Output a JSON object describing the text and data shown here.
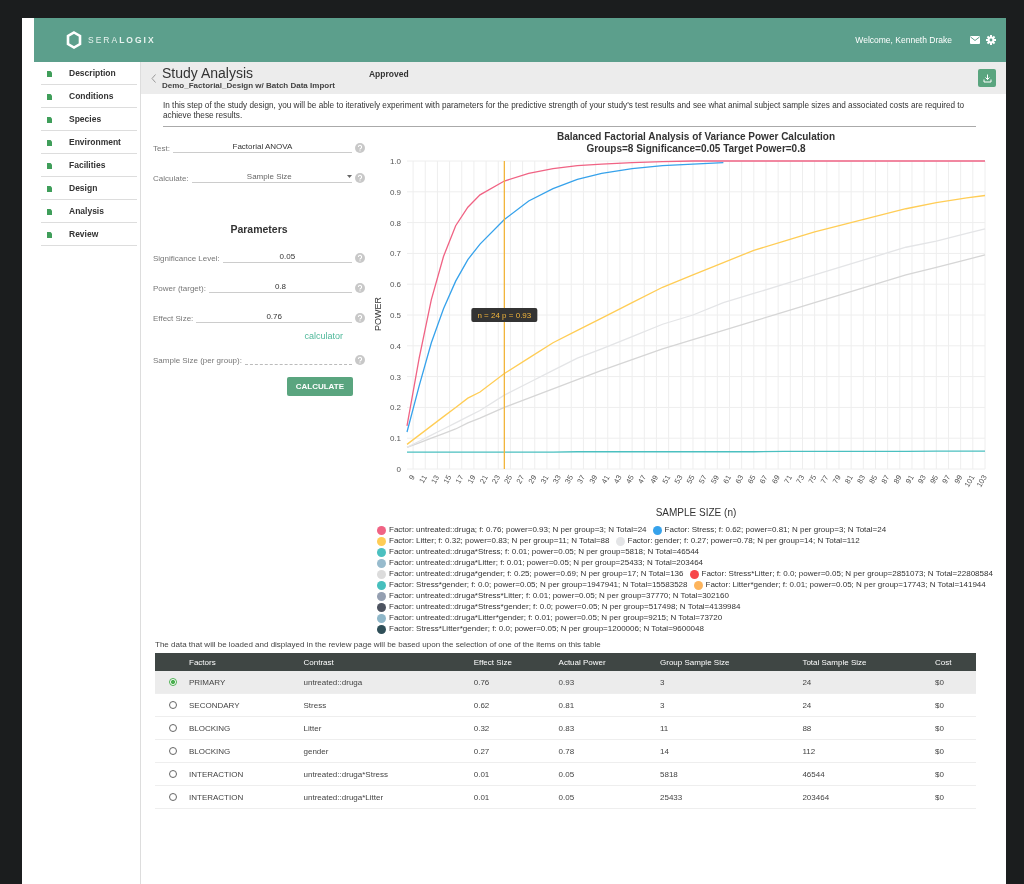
{
  "header": {
    "logo": "SERA**LOGIX**",
    "welcome": "Welcome, Kenneth Drake"
  },
  "sidebar": {
    "items": [
      {
        "label": "Description"
      },
      {
        "label": "Conditions"
      },
      {
        "label": "Species"
      },
      {
        "label": "Environment"
      },
      {
        "label": "Facilities"
      },
      {
        "label": "Design"
      },
      {
        "label": "Analysis"
      },
      {
        "label": "Review"
      }
    ]
  },
  "page": {
    "title": "Study Analysis",
    "subtitle": "Demo_Factorial_Design w/ Batch Data Import",
    "status": "Approved"
  },
  "intro": "In this step of the study design, you will be able to iteratively experiment with parameters for the predictive strength of your study's test results and see what animal subject sample sizes and associated costs are required to achieve these results.",
  "form": {
    "test": {
      "label": "Test:",
      "value": "Factorial ANOVA"
    },
    "calculate": {
      "label": "Calculate:",
      "value": "Sample Size"
    },
    "parameters_title": "Parameters",
    "fields": [
      {
        "label": "Significance Level:",
        "value": "0.05"
      },
      {
        "label": "Power (target):",
        "value": "0.8"
      },
      {
        "label": "Effect Size:",
        "value": "0.76"
      }
    ],
    "calculator_link": "calculator",
    "sample_size": {
      "label": "Sample Size (per group):"
    },
    "calculate_button": "CALCULATE"
  },
  "chart": {
    "chart_data": {
      "type": "line",
      "title": "Balanced Factorial Analysis of Variance Power Calculation\nGroups=8 Significance=0.05 Target Power=0.8",
      "xlabel": "SAMPLE SIZE (n)",
      "ylabel": "POWER",
      "x": [
        8,
        10,
        12,
        14,
        16,
        18,
        20,
        24,
        28,
        32,
        36,
        40,
        45,
        50,
        55,
        60,
        65,
        70,
        75,
        80,
        85,
        90,
        95,
        100,
        103
      ],
      "series": [
        {
          "color": "#f06384",
          "values": [
            0.14,
            0.36,
            0.55,
            0.69,
            0.79,
            0.85,
            0.89,
            0.935,
            0.96,
            0.975,
            0.985,
            0.99,
            0.995,
            0.998,
            1,
            1,
            1,
            1,
            1,
            1,
            1,
            1,
            1,
            1,
            1
          ]
        },
        {
          "color": "#36a2eb",
          "values": [
            0.12,
            0.27,
            0.41,
            0.52,
            0.61,
            0.68,
            0.73,
            0.81,
            0.87,
            0.91,
            0.94,
            0.96,
            0.975,
            0.985,
            0.99,
            0.995,
            null,
            null,
            null,
            null,
            null,
            null,
            null,
            null,
            null
          ]
        },
        {
          "color": "#ffcd56",
          "values": [
            0.08,
            0.11,
            0.14,
            0.17,
            0.2,
            0.23,
            0.25,
            0.31,
            0.36,
            0.41,
            0.45,
            0.49,
            0.54,
            0.59,
            0.63,
            0.67,
            0.71,
            0.74,
            0.77,
            0.795,
            0.82,
            0.845,
            0.865,
            0.88,
            0.888
          ]
        },
        {
          "color": "#e4e5e7",
          "values": [
            0.07,
            0.09,
            0.11,
            0.13,
            0.15,
            0.17,
            0.19,
            0.24,
            0.28,
            0.32,
            0.36,
            0.39,
            0.43,
            0.47,
            0.5,
            0.54,
            0.57,
            0.6,
            0.63,
            0.66,
            0.69,
            0.72,
            0.74,
            0.765,
            0.78
          ]
        },
        {
          "color": "#d6d6d6",
          "values": [
            0.07,
            0.085,
            0.1,
            0.115,
            0.13,
            0.15,
            0.165,
            0.2,
            0.23,
            0.26,
            0.29,
            0.32,
            0.355,
            0.39,
            0.42,
            0.45,
            0.48,
            0.51,
            0.54,
            0.57,
            0.6,
            0.63,
            0.655,
            0.68,
            0.695
          ]
        },
        {
          "color": "#4bc0c0",
          "values": [
            0.055,
            0.055,
            0.055,
            0.055,
            0.055,
            0.055,
            0.055,
            0.055,
            0.055,
            0.055,
            0.056,
            0.056,
            0.056,
            0.056,
            0.056,
            0.056,
            0.056,
            0.057,
            0.057,
            0.057,
            0.057,
            0.057,
            0.058,
            0.058,
            0.058
          ]
        }
      ],
      "xlim": [
        8,
        103
      ],
      "ylim": [
        0,
        1
      ],
      "xticks": [
        9,
        11,
        13,
        15,
        17,
        19,
        21,
        23,
        25,
        27,
        29,
        31,
        33,
        35,
        37,
        39,
        41,
        43,
        45,
        47,
        49,
        51,
        53,
        55,
        57,
        59,
        61,
        63,
        65,
        67,
        69,
        71,
        73,
        75,
        77,
        79,
        81,
        83,
        85,
        87,
        89,
        91,
        93,
        95,
        97,
        99,
        101,
        103
      ],
      "yticks": [
        0,
        0.1,
        0.2,
        0.3,
        0.4,
        0.5,
        0.6,
        0.7,
        0.8,
        0.9,
        {
          "value": 1,
          "label": "1.0"
        }
      ],
      "grid": true,
      "ref_lines": [
        {
          "axis": "x",
          "value": 24
        }
      ],
      "annotations": [
        "n = 24 p = 0.93"
      ]
    },
    "legend": [
      {
        "label": "Factor: untreated::druga; f: 0.76; power=0.93; N per group=3; N Total=24",
        "color": "#f06384"
      },
      {
        "label": "Factor: Stress; f: 0.62; power=0.81; N per group=3; N Total=24",
        "color": "#36a2eb"
      },
      {
        "label": "Factor: Litter; f: 0.32; power=0.83; N per group=11; N Total=88",
        "color": "#ffcd56"
      },
      {
        "label": "Factor: gender; f: 0.27; power=0.78; N per group=14; N Total=112",
        "color": "#e4e5e7"
      },
      {
        "label": "Factor: untreated::druga*Stress; f: 0.01; power=0.05; N per group=5818; N Total=46544",
        "color": "#4bc0c0"
      },
      {
        "label": "Factor: untreated::druga*Litter; f: 0.01; power=0.05; N per group=25433; N Total=203464",
        "color": "#97bbcd"
      },
      {
        "label": "Factor: untreated::druga*gender; f: 0.25; power=0.69; N per group=17; N Total=136",
        "color": "#dcdcdc"
      },
      {
        "label": "Factor: Stress*Litter; f: 0.0; power=0.05; N per group=2851073; N Total=22808584",
        "color": "#f7464a"
      },
      {
        "label": "Factor: Stress*gender; f: 0.0; power=0.05; N per group=1947941; N Total=15583528",
        "color": "#46bfbd"
      },
      {
        "label": "Factor: Litter*gender; f: 0.01; power=0.05; N per group=17743; N Total=141944",
        "color": "#fdb45c"
      },
      {
        "label": "Factor: untreated::druga*Stress*Litter; f: 0.01; power=0.05; N per group=37770; N Total=302160",
        "color": "#949fb1"
      },
      {
        "label": "Factor: untreated::druga*Stress*gender; f: 0.0; power=0.05; N per group=517498; N Total=4139984",
        "color": "#4d5360"
      },
      {
        "label": "Factor: untreated::druga*Litter*gender; f: 0.01; power=0.05; N per group=9215; N Total=73720",
        "color": "#8fb7c9"
      },
      {
        "label": "Factor: Stress*Litter*gender; f: 0.0; power=0.05; N per group=1200006; N Total=9600048",
        "color": "#2f4f58"
      }
    ]
  },
  "table": {
    "caption": "The data that will be loaded and displayed in the review page will be based upon the selection of one of the items on this table",
    "columns": [
      "Factors",
      "Contrast",
      "Effect Size",
      "Actual Power",
      "Group Sample Size",
      "Total Sample Size",
      "Cost"
    ],
    "rows": [
      {
        "selected": true,
        "cells": [
          "PRIMARY",
          "untreated::druga",
          "0.76",
          "0.93",
          "3",
          "24",
          "$0"
        ]
      },
      {
        "selected": false,
        "cells": [
          "SECONDARY",
          "Stress",
          "0.62",
          "0.81",
          "3",
          "24",
          "$0"
        ]
      },
      {
        "selected": false,
        "cells": [
          "BLOCKING",
          "Litter",
          "0.32",
          "0.83",
          "11",
          "88",
          "$0"
        ]
      },
      {
        "selected": false,
        "cells": [
          "BLOCKING",
          "gender",
          "0.27",
          "0.78",
          "14",
          "112",
          "$0"
        ]
      },
      {
        "selected": false,
        "cells": [
          "INTERACTION",
          "untreated::druga*Stress",
          "0.01",
          "0.05",
          "5818",
          "46544",
          "$0"
        ]
      },
      {
        "selected": false,
        "cells": [
          "INTERACTION",
          "untreated::druga*Litter",
          "0.01",
          "0.05",
          "25433",
          "203464",
          "$0"
        ]
      }
    ]
  }
}
